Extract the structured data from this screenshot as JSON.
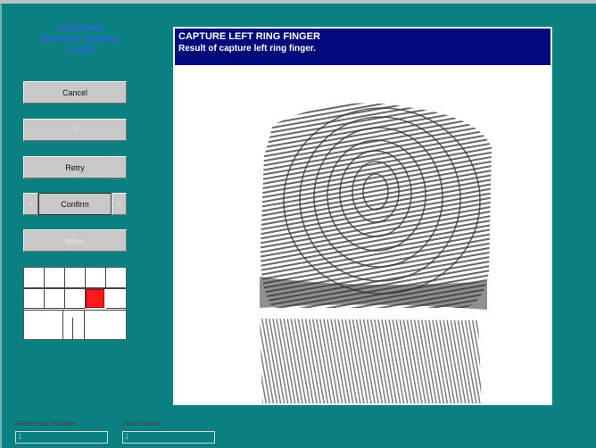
{
  "brand": {
    "line1": "HEIMANN",
    "line2": "Biometric Systems",
    "line3": "GmbH"
  },
  "buttons": {
    "cancel": "Cancel",
    "help": "?",
    "retry": "Retry",
    "prev": "<",
    "confirm": "Confirm",
    "next": ">",
    "down": "down"
  },
  "panel": {
    "title": "CAPTURE LEFT RING FINGER",
    "subtitle": "Result of capture left ring finger."
  },
  "fields": {
    "reference_label": "Reference Number",
    "reference_value": "1",
    "alias_label": "Alias Name",
    "alias_value": "1"
  },
  "colors": {
    "background": "#0b8080",
    "title_bar": "#000a7a",
    "selected_finger": "#ff1a1a"
  },
  "hand_map": {
    "selected_finger": "left-ring"
  }
}
